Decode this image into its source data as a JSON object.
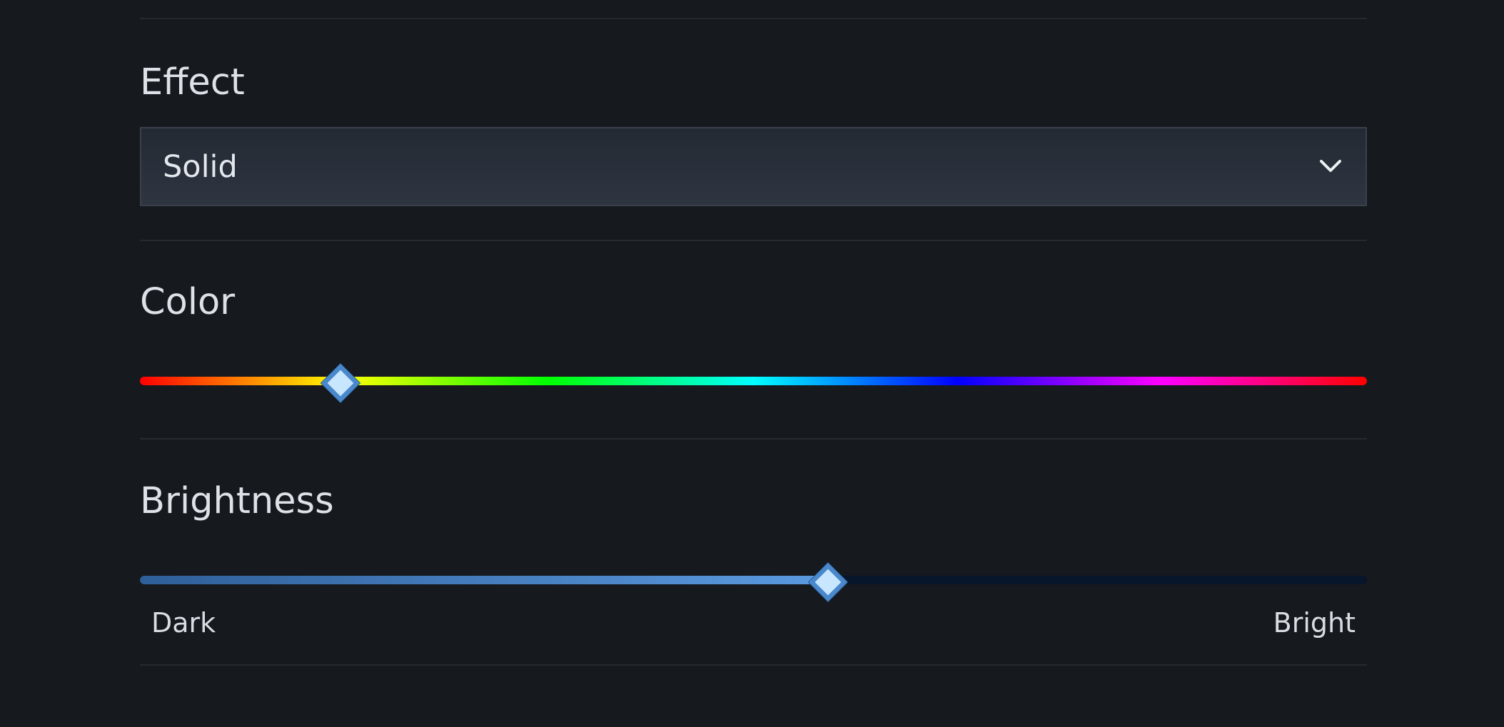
{
  "effect": {
    "label": "Effect",
    "selected": "Solid",
    "icon": "chevron-down-icon"
  },
  "color": {
    "label": "Color",
    "hue_fraction": 0.162,
    "hue_gradient": [
      "#ff0000",
      "#ff8000",
      "#ffff00",
      "#80ff00",
      "#00ff00",
      "#00ff80",
      "#00ffff",
      "#0080ff",
      "#0000ff",
      "#8000ff",
      "#ff00ff",
      "#ff0080",
      "#ff0000"
    ]
  },
  "brightness": {
    "label": "Brightness",
    "fraction": 0.559,
    "min_label": "Dark",
    "max_label": "Bright"
  },
  "colors": {
    "background": "#16191e",
    "accent": "#5b9ae0",
    "divider": "#262a30"
  }
}
